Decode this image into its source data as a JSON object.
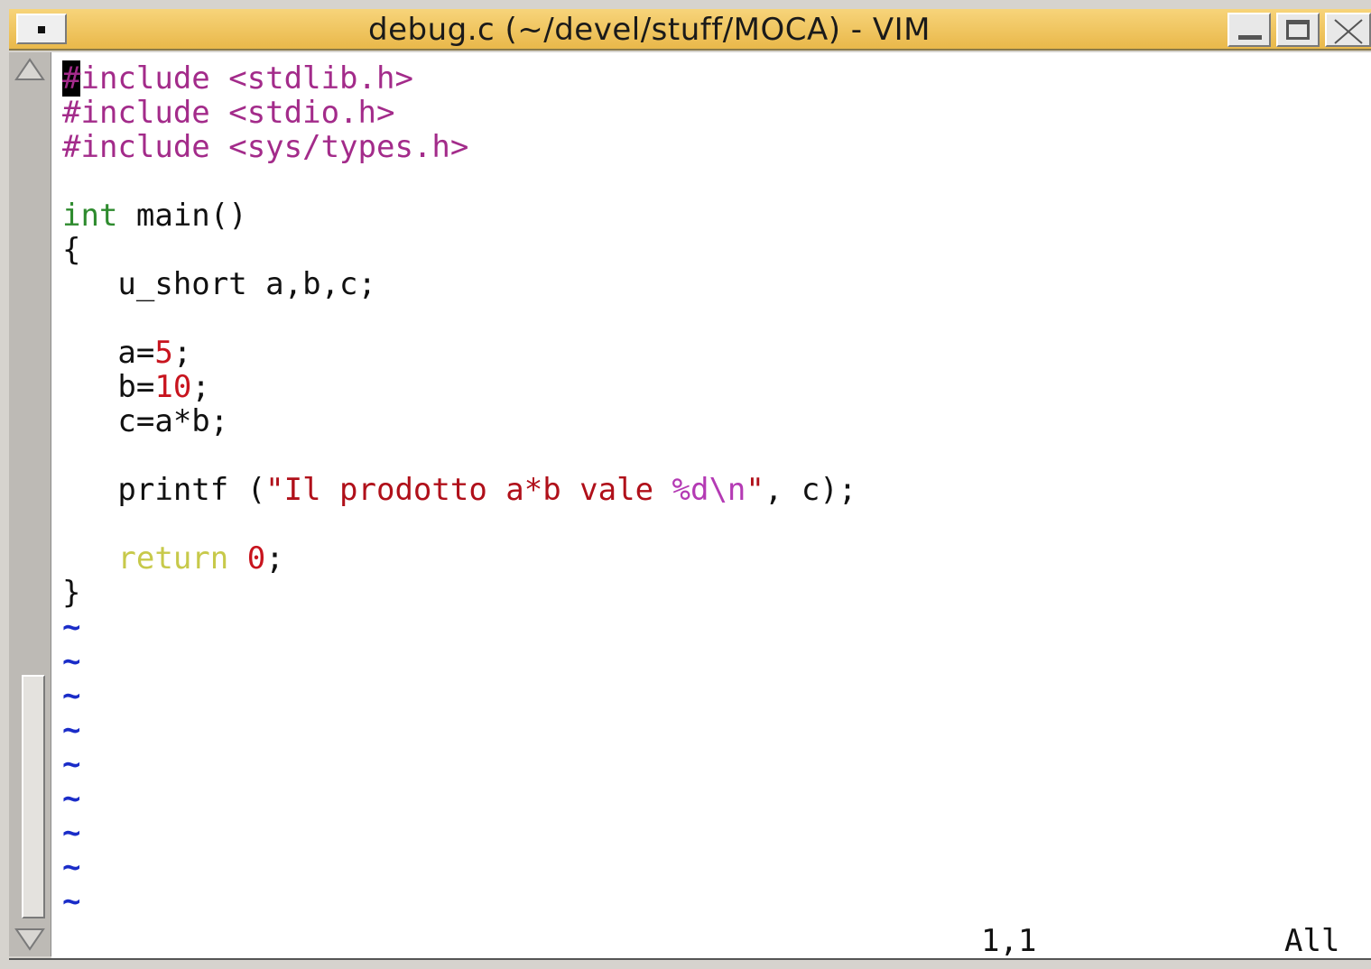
{
  "window": {
    "title": "debug.c (~/devel/stuff/MOCA) - VIM"
  },
  "editor": {
    "code": {
      "l1_cursor": "#",
      "l1_rest": "include <stdlib.h>",
      "l2": "#include <stdio.h>",
      "l3": "#include <sys/types.h>",
      "l5_type": "int",
      "l5_rest": " main()",
      "l6": "{",
      "l7": "   u_short a,b,c;",
      "l9_a": "   a=",
      "l9_num": "5",
      "l9_end": ";",
      "l10_a": "   b=",
      "l10_num": "10",
      "l10_end": ";",
      "l11": "   c=a*b;",
      "l13_a": "   printf (",
      "l13_str": "\"Il prodotto a*b vale ",
      "l13_esc": "%d\\n",
      "l13_strend": "\"",
      "l13_end": ", c);",
      "l15_kw": "   return",
      "l15_sp": " ",
      "l15_num": "0",
      "l15_end": ";",
      "l16": "}"
    },
    "empty_line_marker": "~"
  },
  "statusline": {
    "position": "1,1",
    "scroll": "All"
  }
}
